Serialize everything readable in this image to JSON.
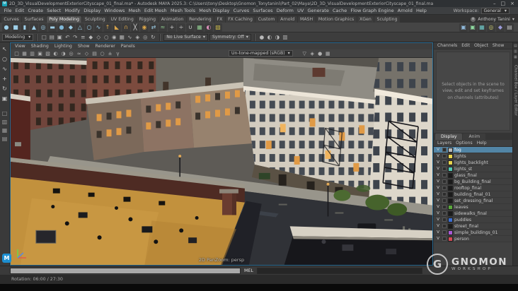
{
  "window": {
    "app_initial": "M",
    "title": "2D_3D_VisualDevelopmentExteriorCityscape_01_final.ma* - Autodesk MAYA 2025.3: C:\\Users\\tony\\Desktop\\Gnomon_Tonytanini\\Part_02\\Maya\\2D_3D_VisualDevelopmentExteriorCityscape_01_final.ma",
    "controls": {
      "minimize": "–",
      "maximize": "□",
      "close": "×"
    }
  },
  "menubar": {
    "items": [
      "File",
      "Edit",
      "Create",
      "Select",
      "Modify",
      "Display",
      "Windows",
      "Mesh",
      "Edit Mesh",
      "Mesh Tools",
      "Mesh Display",
      "Curves",
      "Surfaces",
      "Deform",
      "UV",
      "Generate",
      "Cache",
      "Flow Graph Engine",
      "Arnold",
      "Help"
    ],
    "workspace_label": "Workspace:",
    "workspace_value": "General",
    "caret": "▾"
  },
  "shelf": {
    "tabs": [
      {
        "label": "Curves"
      },
      {
        "label": "Surfaces"
      },
      {
        "label": "Poly Modeling",
        "active": true
      },
      {
        "label": "Sculpting"
      },
      {
        "label": "UV Editing"
      },
      {
        "label": "Rigging"
      },
      {
        "label": "Animation"
      },
      {
        "label": "Rendering"
      },
      {
        "label": "FX"
      },
      {
        "label": "FX Caching"
      },
      {
        "label": "Custom"
      },
      {
        "label": "Arnold"
      },
      {
        "label": "MASH"
      },
      {
        "label": "Motion Graphics"
      },
      {
        "label": "XGen"
      },
      {
        "label": "Sculpting"
      }
    ],
    "icons": [
      {
        "name": "poly-sphere-icon",
        "glyph": "●",
        "color": "#9ecfe8"
      },
      {
        "name": "poly-cube-icon",
        "glyph": "■",
        "color": "#9ecfe8"
      },
      {
        "name": "poly-cylinder-icon",
        "glyph": "▮",
        "color": "#9ecfe8"
      },
      {
        "name": "poly-cone-icon",
        "glyph": "▲",
        "color": "#9ecfe8"
      },
      {
        "name": "poly-torus-icon",
        "glyph": "◎",
        "color": "#9ecfe8"
      },
      {
        "name": "poly-plane-icon",
        "glyph": "▬",
        "color": "#9ecfe8"
      },
      {
        "name": "poly-disc-icon",
        "glyph": "●",
        "color": "#7fb8d8"
      },
      {
        "name": "poly-platonic-icon",
        "glyph": "◆",
        "color": "#9ecfe8"
      },
      {
        "name": "poly-pyramid-icon",
        "glyph": "△",
        "color": "#9ecfe8"
      },
      {
        "name": "poly-pipe-icon",
        "glyph": "○",
        "color": "#9ecfe8"
      },
      {
        "name": "poly-helix-icon",
        "glyph": "∿",
        "color": "#9ecfe8"
      },
      {
        "name": "extrude-icon",
        "glyph": "↑",
        "color": "#d9a54a"
      },
      {
        "name": "bevel-icon",
        "glyph": "◣",
        "color": "#d9a54a"
      },
      {
        "name": "bridge-icon",
        "glyph": "∩",
        "color": "#d9a54a"
      },
      {
        "name": "multi-cut-icon",
        "glyph": "╳",
        "color": "#e0e0e0"
      },
      {
        "name": "target-weld-icon",
        "glyph": "◉",
        "color": "#d9a54a"
      },
      {
        "name": "mirror-icon",
        "glyph": "⇄",
        "color": "#9ecfe8"
      },
      {
        "name": "smooth-icon",
        "glyph": "≈",
        "color": "#8fc98f"
      },
      {
        "name": "combine-icon",
        "glyph": "+",
        "color": "#d0d0d0"
      },
      {
        "name": "separate-icon",
        "glyph": "÷",
        "color": "#d0d0d0"
      },
      {
        "name": "boolean-icon",
        "glyph": "∪",
        "color": "#d0d0d0"
      },
      {
        "name": "quad-draw-icon",
        "glyph": "▦",
        "color": "#8fc98f"
      },
      {
        "name": "sculpt-icon",
        "glyph": "◐",
        "color": "#d98fb8"
      },
      {
        "name": "lattice-icon",
        "glyph": "▧",
        "color": "#c9b84a"
      }
    ],
    "icons_right": [
      {
        "name": "shelf-extra-icon-1",
        "glyph": "▣",
        "color": "#8fb8d9"
      },
      {
        "name": "shelf-extra-icon-2",
        "glyph": "▣",
        "color": "#8fd9a0"
      },
      {
        "name": "shelf-extra-icon-3",
        "glyph": "▦",
        "color": "#6fc9c9"
      },
      {
        "name": "shelf-extra-icon-4",
        "glyph": "◎",
        "color": "#c9c96f"
      },
      {
        "name": "shelf-extra-icon-5",
        "glyph": "◆",
        "color": "#9a9ad9"
      },
      {
        "name": "shelf-extra-icon-6",
        "glyph": "▤",
        "color": "#bdbdbd"
      }
    ]
  },
  "account": {
    "name": "Anthony Tanini",
    "caret": "▾"
  },
  "statusline": {
    "module": "Modeling",
    "caret": "▾",
    "icons_left": [
      {
        "name": "new-scene-icon",
        "glyph": "□"
      },
      {
        "name": "open-scene-icon",
        "glyph": "▤"
      },
      {
        "name": "save-scene-icon",
        "glyph": "▣"
      },
      {
        "name": "undo-icon",
        "glyph": "↶"
      },
      {
        "name": "redo-icon",
        "glyph": "↷"
      },
      {
        "name": "select-hierarchy-icon",
        "glyph": "≡"
      },
      {
        "name": "select-object-icon",
        "glyph": "◆"
      },
      {
        "name": "select-component-icon",
        "glyph": "◇"
      },
      {
        "name": "select-by-type-icon",
        "glyph": "○"
      },
      {
        "name": "highlight-selection-icon",
        "glyph": "◉"
      },
      {
        "name": "snap-to-grid-icon",
        "glyph": "▦"
      },
      {
        "name": "snap-to-curve-icon",
        "glyph": "∿"
      },
      {
        "name": "snap-to-point-icon",
        "glyph": "◈"
      },
      {
        "name": "snap-to-plane-icon",
        "glyph": "◎"
      },
      {
        "name": "construction-history-icon",
        "glyph": "↻"
      }
    ],
    "no_live_surface": "No Live Surface",
    "symmetry": "Symmetry: Off",
    "icons_right": [
      {
        "name": "render-icon",
        "glyph": "●"
      },
      {
        "name": "ipr-render-icon",
        "glyph": "◐"
      },
      {
        "name": "render-settings-icon",
        "glyph": "◑"
      },
      {
        "name": "hypershade-icon",
        "glyph": "▥"
      }
    ]
  },
  "toolbox": {
    "tools": [
      {
        "name": "select-tool-icon",
        "glyph": "↖"
      },
      {
        "name": "lasso-tool-icon",
        "glyph": "○"
      },
      {
        "name": "paint-selection-tool-icon",
        "glyph": "∿"
      },
      {
        "name": "move-tool-icon",
        "glyph": "+"
      },
      {
        "name": "rotate-tool-icon",
        "glyph": "↻"
      },
      {
        "name": "scale-tool-icon",
        "glyph": "▣"
      }
    ],
    "layouts": [
      {
        "name": "layout-single-pane-icon",
        "glyph": "□"
      },
      {
        "name": "layout-two-pane-icon",
        "glyph": "▥"
      },
      {
        "name": "layout-four-pane-icon",
        "glyph": "▦"
      },
      {
        "name": "layout-outliner-icon",
        "glyph": "▤"
      }
    ]
  },
  "viewport": {
    "menus": [
      "View",
      "Shading",
      "Lighting",
      "Show",
      "Renderer",
      "Panels"
    ],
    "toolbar_icons_left": [
      {
        "name": "camera-lock-icon",
        "glyph": "□"
      },
      {
        "name": "grid-toggle-icon",
        "glyph": "▦"
      },
      {
        "name": "film-gate-icon",
        "glyph": "▥"
      },
      {
        "name": "resolution-gate-icon",
        "glyph": "▣"
      },
      {
        "name": "gate-mask-icon",
        "glyph": "▧"
      },
      {
        "name": "lighting-icon",
        "glyph": "◐"
      },
      {
        "name": "shadows-icon",
        "glyph": "◑"
      },
      {
        "name": "ambient-occlusion-icon",
        "glyph": "◎"
      },
      {
        "name": "anti-aliasing-icon",
        "glyph": "≈"
      },
      {
        "name": "xray-icon",
        "glyph": "◇"
      },
      {
        "name": "textured-icon",
        "glyph": "▤"
      },
      {
        "name": "isolate-select-icon",
        "glyph": "○"
      },
      {
        "name": "exposure-icon",
        "glyph": "±"
      },
      {
        "name": "gamma-icon",
        "glyph": "γ"
      }
    ],
    "tonemap": "Un-tone-mapped (sRGB)",
    "tonemap_caret": "▾",
    "toolbar_icons_right": [
      {
        "name": "viewport-extra-icon-1",
        "glyph": "▽"
      },
      {
        "name": "viewport-extra-icon-2",
        "glyph": "◈"
      },
      {
        "name": "viewport-extra-icon-3",
        "glyph": "●"
      },
      {
        "name": "viewport-extra-icon-4",
        "glyph": "▦"
      }
    ],
    "overlay_bottom": "2D PanZoom: persp"
  },
  "channel_box": {
    "menus": [
      "Channels",
      "Edit",
      "Object",
      "Show"
    ],
    "empty_message": "Select objects in the scene to view, edit and set keyframes on channels (attributes)"
  },
  "layer_editor": {
    "tabs": [
      {
        "label": "Display",
        "active": true
      },
      {
        "label": "Anim"
      }
    ],
    "menus": [
      "Layers",
      "Options",
      "Help"
    ],
    "layers": [
      {
        "vis": "V",
        "name": "fog",
        "swatch": "#b8b8b8",
        "selected": true
      },
      {
        "vis": "V",
        "name": "lights",
        "swatch": "#e8d44d"
      },
      {
        "vis": "V",
        "name": "lights_backlight",
        "swatch": "#e8d44d"
      },
      {
        "vis": "V",
        "name": "lights_st",
        "swatch": "#52c9b4"
      },
      {
        "vis": "V",
        "name": "glass_final",
        "swatch": "#1a1a1a"
      },
      {
        "vis": "V",
        "name": "bg_Building_final",
        "swatch": "#1a1a1a"
      },
      {
        "vis": "V",
        "name": "rooftop_final",
        "swatch": "#1a1a1a"
      },
      {
        "vis": "V",
        "name": "building_final_01",
        "swatch": "#1a1a1a"
      },
      {
        "vis": "V",
        "name": "set_dressing_final",
        "swatch": "#1a1a1a"
      },
      {
        "vis": "V",
        "name": "leaves",
        "swatch": "#5aa83c"
      },
      {
        "vis": "V",
        "name": "sidewalks_final",
        "swatch": "#1a1a1a"
      },
      {
        "vis": "V",
        "name": "puddles",
        "swatch": "#3b6fd4"
      },
      {
        "vis": "V",
        "name": "street_final",
        "swatch": "#1a1a1a"
      },
      {
        "vis": "V",
        "name": "simple_buildings_01",
        "swatch": "#a85ad4"
      },
      {
        "vis": "V",
        "name": "person",
        "swatch": "#d44a55"
      }
    ]
  },
  "sidebar_right": {
    "icons": [
      {
        "name": "attribute-editor-toggle-icon",
        "glyph": "▤"
      },
      {
        "name": "tool-settings-toggle-icon",
        "glyph": "▥"
      },
      {
        "name": "channel-box-toggle-icon",
        "glyph": "▦"
      }
    ],
    "labels": [
      "Channel Box / Layer Editor"
    ]
  },
  "command_line": {
    "label": "MEL"
  },
  "help_line": {
    "text": "Rotation: 06:00 / 27:30"
  },
  "watermark": {
    "logo_letter": "G",
    "title": "GNOMON",
    "subtitle": "WORKSHOP"
  },
  "colors": {
    "accent": "#5285a6",
    "lit_window": "#e09a46"
  }
}
